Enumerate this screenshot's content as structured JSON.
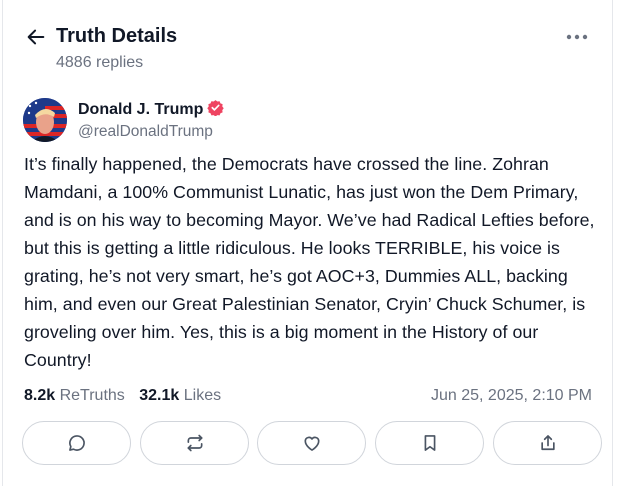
{
  "header": {
    "title": "Truth Details",
    "replies": "4886 replies"
  },
  "author": {
    "name": "Donald J. Trump",
    "handle": "@realDonaldTrump",
    "verified_color": "#ef4461"
  },
  "post": {
    "text": "It’s finally happened, the Democrats have crossed the line. Zohran Mamdani, a 100% Communist Lunatic, has just won the Dem Primary, and is on his way to becoming Mayor. We’ve had Radical Lefties before, but this is getting a little ridiculous. He looks TERRIBLE, his voice is grating, he’s not very smart, he’s got AOC+3, Dummies ALL, backing him, and even our Great Palestinian Senator, Cryin’ Chuck Schumer, is groveling over him. Yes, this is a big moment in the History of our Country!"
  },
  "stats": {
    "retruths_count": "8.2k",
    "retruths_label": "ReTruths",
    "likes_count": "32.1k",
    "likes_label": "Likes",
    "timestamp": "Jun 25, 2025, 2:10 PM"
  },
  "actions": [
    {
      "icon": "reply-icon"
    },
    {
      "icon": "retruth-icon"
    },
    {
      "icon": "like-icon"
    },
    {
      "icon": "bookmark-icon"
    },
    {
      "icon": "share-icon"
    }
  ]
}
